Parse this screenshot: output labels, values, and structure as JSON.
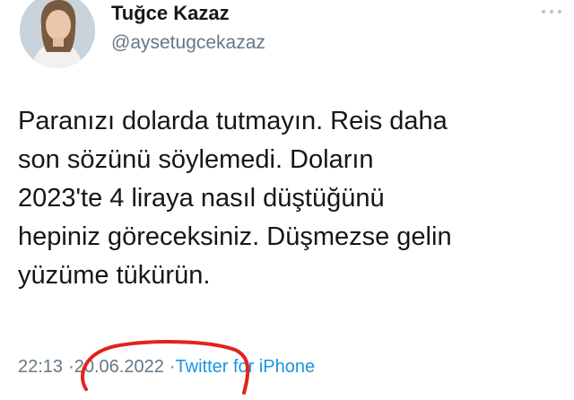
{
  "profile": {
    "display_name": "Tuğce Kazaz",
    "handle": "@aysetugcekazaz"
  },
  "tweet": {
    "text": "Paranızı dolarda tutmayın. Reis daha\nson sözünü söylemedi. Doların\n2023'te 4 liraya nasıl düştüğünü\nhepiniz göreceksiniz. Düşmezse gelin\nyüzüme tükürün."
  },
  "meta": {
    "time": "22:13",
    "separator": "·",
    "date": "20.06.2022",
    "source": "Twitter for iPhone"
  },
  "icons": {
    "more": "more-dots-icon"
  },
  "colors": {
    "text": "#14171a",
    "muted": "#657786",
    "link": "#1b95e0",
    "annotation_circle": "#e0241b"
  }
}
